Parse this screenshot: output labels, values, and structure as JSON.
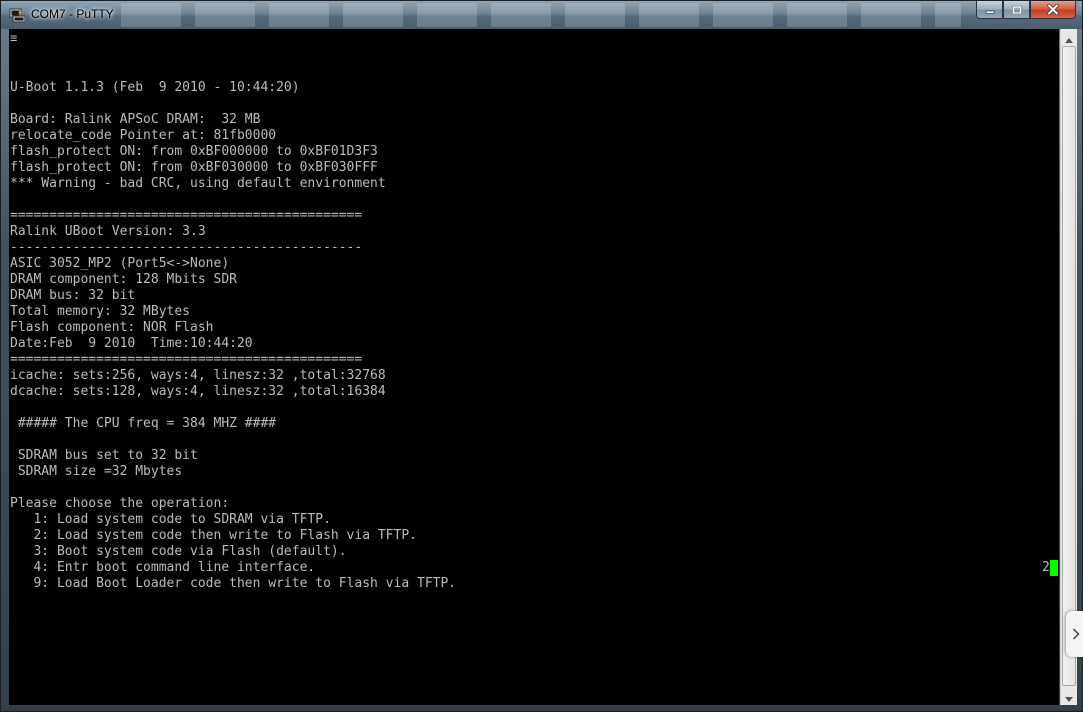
{
  "window": {
    "title": "COM7 - PuTTY"
  },
  "colors": {
    "terminal_background": "#000000",
    "terminal_text": "#bbbbbb",
    "cursor": "#00ff00",
    "close_button": "#c23b1c"
  },
  "icons": {
    "app": "putty-icon",
    "minimize": "minimize-icon",
    "maximize": "maximize-icon",
    "close": "close-icon",
    "scroll_up": "arrow-up-icon",
    "scroll_down": "arrow-down-icon",
    "side_tab": "chevron-right-icon"
  },
  "terminal": {
    "top_glyph": "≡",
    "lines": [
      "",
      "U-Boot 1.1.3 (Feb  9 2010 - 10:44:20)",
      "",
      "Board: Ralink APSoC DRAM:  32 MB",
      "relocate_code Pointer at: 81fb0000",
      "flash_protect ON: from 0xBF000000 to 0xBF01D3F3",
      "flash_protect ON: from 0xBF030000 to 0xBF030FFF",
      "*** Warning - bad CRC, using default environment",
      "",
      "=============================================",
      "Ralink UBoot Version: 3.3",
      "---------------------------------------------",
      "ASIC 3052_MP2 (Port5<->None)",
      "DRAM component: 128 Mbits SDR",
      "DRAM bus: 32 bit",
      "Total memory: 32 MBytes",
      "Flash component: NOR Flash",
      "Date:Feb  9 2010  Time:10:44:20",
      "=============================================",
      "icache: sets:256, ways:4, linesz:32 ,total:32768",
      "dcache: sets:128, ways:4, linesz:32 ,total:16384",
      "",
      " ##### The CPU freq = 384 MHZ ####",
      "",
      " SDRAM bus set to 32 bit",
      " SDRAM size =32 Mbytes",
      "",
      "Please choose the operation:",
      "   1: Load system code to SDRAM via TFTP.",
      "   2: Load system code then write to Flash via TFTP.",
      "   3: Boot system code via Flash (default).",
      "   4: Entr boot command line interface.",
      "   9: Load Boot Loader code then write to Flash via TFTP."
    ],
    "countdown": "2"
  }
}
